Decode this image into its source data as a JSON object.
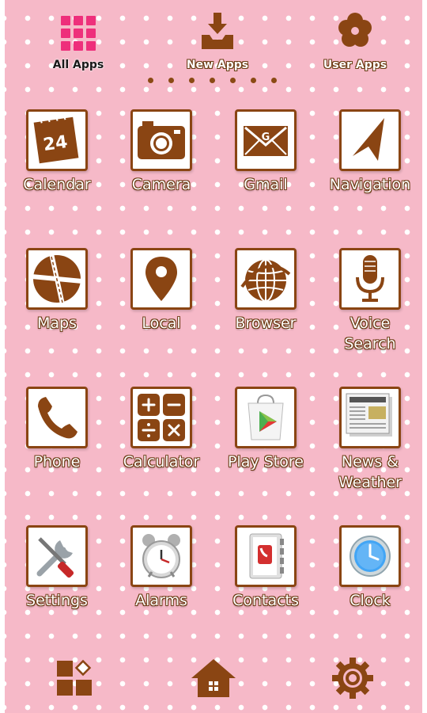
{
  "tabs": [
    {
      "label": "All Apps",
      "icon": "grid-icon",
      "color": "#1a1a1a"
    },
    {
      "label": "New Apps",
      "icon": "inbox-download-icon",
      "color": "#ffffff"
    },
    {
      "label": "User Apps",
      "icon": "flower-icon",
      "color": "#ffffff"
    }
  ],
  "pager": {
    "count": 7
  },
  "apps": [
    {
      "label": "Calendar",
      "icon": "calendar-icon",
      "date": "24"
    },
    {
      "label": "Camera",
      "icon": "camera-icon"
    },
    {
      "label": "Gmail",
      "icon": "gmail-envelope-icon",
      "letter": "G"
    },
    {
      "label": "Navigation",
      "icon": "navigation-arrow-icon"
    },
    {
      "label": "Maps",
      "icon": "maps-icon"
    },
    {
      "label": "Local",
      "icon": "location-pin-icon"
    },
    {
      "label": "Browser",
      "icon": "globe-icon"
    },
    {
      "label": "Voice\nSearch",
      "icon": "microphone-icon"
    },
    {
      "label": "Phone",
      "icon": "phone-handset-icon"
    },
    {
      "label": "Calculator",
      "icon": "calculator-icon"
    },
    {
      "label": "Play Store",
      "icon": "play-store-icon"
    },
    {
      "label": "News &\nWeather",
      "icon": "newspaper-icon"
    },
    {
      "label": "Settings",
      "icon": "tools-icon"
    },
    {
      "label": "Alarms",
      "icon": "alarm-clock-icon"
    },
    {
      "label": "Contacts",
      "icon": "contacts-book-icon"
    },
    {
      "label": "Clock",
      "icon": "clock-icon"
    }
  ],
  "dock": [
    {
      "icon": "widgets-icon"
    },
    {
      "icon": "home-icon"
    },
    {
      "icon": "gear-icon"
    }
  ],
  "colors": {
    "background": "#f6b9c8",
    "dots": "#ffffff",
    "brown": "#8a4513",
    "pink_accent": "#ee2f7b"
  }
}
